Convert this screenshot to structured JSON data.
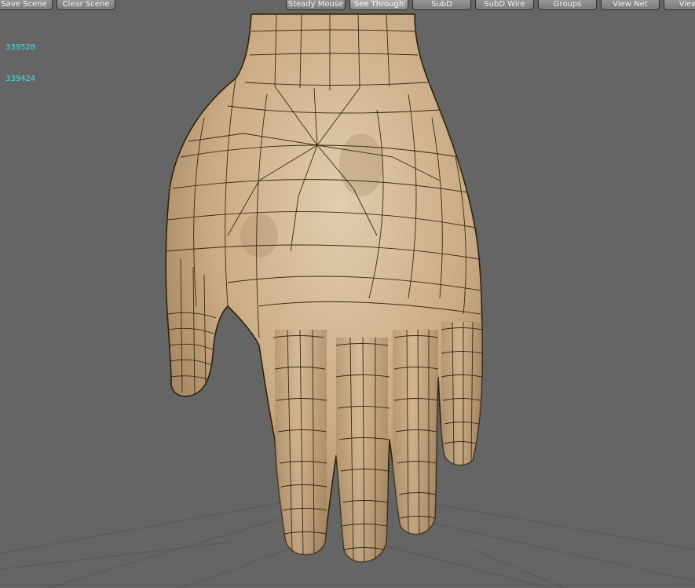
{
  "toolbar": {
    "buttons": [
      {
        "label": "Save Scene",
        "active": false
      },
      {
        "label": "Clear Scene",
        "active": false
      },
      {
        "label": "Steady Mouse",
        "active": false
      },
      {
        "label": "See Through",
        "active": true
      },
      {
        "label": "SubD",
        "active": false
      },
      {
        "label": "SubD Wire",
        "active": false
      },
      {
        "label": "Groups",
        "active": false
      },
      {
        "label": "View Net",
        "active": false
      },
      {
        "label": "View M",
        "active": false
      }
    ]
  },
  "stats": {
    "line1": "339528",
    "line2": "339424"
  },
  "viewport": {
    "object": "hand-mesh",
    "background_color": "#656565",
    "skin_color": "#c9aa84",
    "wire_color": "#3a2a0c",
    "grid_color": "#575757",
    "readout_color": "#33e6f0"
  }
}
